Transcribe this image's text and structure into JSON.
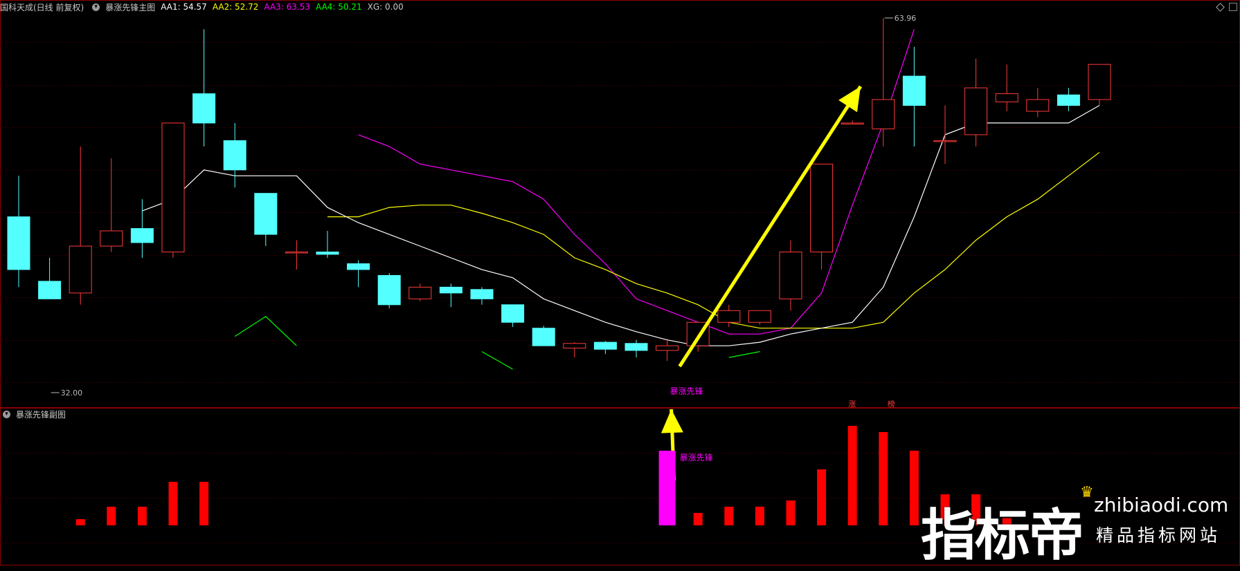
{
  "main_panel": {
    "title": "国科天成(日线 前复权)",
    "indicator": "暴涨先锋主图",
    "values": [
      {
        "label": "AA1: 54.57",
        "color": "#ffffff"
      },
      {
        "label": "AA2: 52.72",
        "color": "#ffff00"
      },
      {
        "label": "AA3: 63.53",
        "color": "#ff00ff"
      },
      {
        "label": "AA4: 50.21",
        "color": "#00ff00"
      },
      {
        "label": "XG: 0.00",
        "color": "#c8c8c8"
      }
    ],
    "high_marker": "63.96",
    "low_marker": "32.00",
    "signal_label": "暴涨先锋",
    "tag_zhang": "涨",
    "tag_bang": "榜"
  },
  "sub_panel": {
    "title": "暴涨先锋副图",
    "signal_label": "暴涨先锋"
  },
  "watermark": {
    "brand": "指标帝",
    "url": "zhibiaodi.com",
    "slogan": "精品指标网站"
  },
  "colors": {
    "up": "#ff3b3b",
    "down": "#54ffff",
    "grid": "#5a0000",
    "aa1": "#ffffff",
    "aa2": "#ffff00",
    "aa3": "#ff00ff",
    "aa4": "#00ff00",
    "arrow": "#ffff00",
    "signal_bar": "#ff00ff",
    "volume_bar": "#ff0000"
  },
  "chart_data": {
    "type": "candlestick",
    "price_range": [
      32.0,
      63.96
    ],
    "candles": [
      {
        "o": 47.0,
        "h": 50.5,
        "l": 41.0,
        "c": 42.5
      },
      {
        "o": 41.5,
        "h": 43.5,
        "l": 40.5,
        "c": 40.0
      },
      {
        "o": 40.5,
        "h": 53.0,
        "l": 39.5,
        "c": 44.5
      },
      {
        "o": 44.5,
        "h": 52.0,
        "l": 44.0,
        "c": 45.8
      },
      {
        "o": 46.0,
        "h": 48.5,
        "l": 43.5,
        "c": 44.8
      },
      {
        "o": 44.0,
        "h": 55.0,
        "l": 43.5,
        "c": 55.0
      },
      {
        "o": 57.5,
        "h": 63.0,
        "l": 53.0,
        "c": 55.0
      },
      {
        "o": 53.5,
        "h": 55.0,
        "l": 49.5,
        "c": 51.0
      },
      {
        "o": 49.0,
        "h": 48.8,
        "l": 44.5,
        "c": 45.5
      },
      {
        "o": 44.0,
        "h": 45.0,
        "l": 42.5,
        "c": 44.0
      },
      {
        "o": 44.0,
        "h": 45.8,
        "l": 43.5,
        "c": 43.8
      },
      {
        "o": 43.0,
        "h": 43.3,
        "l": 41.0,
        "c": 42.5
      },
      {
        "o": 42.0,
        "h": 42.2,
        "l": 39.2,
        "c": 39.5
      },
      {
        "o": 40.0,
        "h": 41.3,
        "l": 39.8,
        "c": 41.0
      },
      {
        "o": 41.0,
        "h": 41.3,
        "l": 39.3,
        "c": 40.5
      },
      {
        "o": 40.8,
        "h": 41.0,
        "l": 39.5,
        "c": 40.0
      },
      {
        "o": 39.5,
        "h": 39.5,
        "l": 37.6,
        "c": 38.0
      },
      {
        "o": 37.5,
        "h": 37.7,
        "l": 36.0,
        "c": 36.0
      },
      {
        "o": 35.8,
        "h": 36.3,
        "l": 35.0,
        "c": 36.2
      },
      {
        "o": 36.3,
        "h": 36.4,
        "l": 35.3,
        "c": 35.7
      },
      {
        "o": 36.2,
        "h": 36.5,
        "l": 35.0,
        "c": 35.6
      },
      {
        "o": 35.6,
        "h": 36.6,
        "l": 34.7,
        "c": 36.0
      },
      {
        "o": 36.0,
        "h": 38.0,
        "l": 35.5,
        "c": 38.0
      },
      {
        "o": 38.0,
        "h": 39.5,
        "l": 37.6,
        "c": 39.0
      },
      {
        "o": 38.0,
        "h": 39.0,
        "l": 37.8,
        "c": 39.0
      },
      {
        "o": 40.0,
        "h": 45.0,
        "l": 39.0,
        "c": 44.0
      },
      {
        "o": 44.0,
        "h": 50.0,
        "l": 42.5,
        "c": 51.5
      },
      {
        "o": 55.0,
        "h": 55.2,
        "l": 55.0,
        "c": 55.0
      },
      {
        "o": 54.5,
        "h": 63.96,
        "l": 53.0,
        "c": 57.0
      },
      {
        "o": 59.0,
        "h": 61.5,
        "l": 53.0,
        "c": 56.5
      },
      {
        "o": 53.5,
        "h": 56.5,
        "l": 51.5,
        "c": 53.5
      },
      {
        "o": 54.0,
        "h": 60.5,
        "l": 53.0,
        "c": 58.0
      },
      {
        "o": 56.8,
        "h": 60.0,
        "l": 56.0,
        "c": 57.5
      },
      {
        "o": 56.0,
        "h": 58.0,
        "l": 55.5,
        "c": 57.0
      },
      {
        "o": 57.4,
        "h": 58.0,
        "l": 56.0,
        "c": 56.5
      },
      {
        "o": 57.0,
        "h": 60.0,
        "l": 56.5,
        "c": 60.0
      }
    ],
    "aa1": [
      null,
      null,
      null,
      null,
      47.5,
      48.5,
      51.0,
      50.5,
      50.5,
      50.5,
      47.8,
      46.5,
      45.5,
      44.5,
      43.5,
      42.5,
      41.8,
      40.0,
      39.0,
      38.0,
      37.2,
      36.5,
      36.0,
      36.0,
      36.3,
      37.0,
      37.5,
      38.0,
      41.0,
      47.0,
      54.0,
      55.0,
      55.0,
      55.0,
      55.0,
      56.5
    ],
    "aa2": [
      null,
      null,
      null,
      null,
      null,
      null,
      null,
      null,
      null,
      null,
      47.0,
      47.0,
      47.8,
      48.0,
      48.0,
      47.3,
      46.5,
      45.5,
      43.5,
      42.5,
      41.3,
      40.5,
      39.5,
      38.0,
      37.5,
      37.5,
      37.5,
      37.5,
      38.0,
      40.5,
      42.5,
      45.0,
      47.0,
      48.5,
      50.5,
      52.5
    ],
    "aa3": [
      null,
      null,
      null,
      null,
      null,
      null,
      null,
      null,
      null,
      null,
      null,
      54.0,
      53.0,
      51.5,
      51.0,
      50.5,
      50.0,
      48.5,
      45.5,
      43.0,
      40.0,
      39.0,
      38.0,
      37.0,
      37.0,
      37.5,
      40.5,
      48.0,
      55.0,
      63.0,
      null,
      null,
      null,
      null,
      63.5,
      null
    ],
    "aa4": [
      null,
      null,
      null,
      null,
      null,
      null,
      null,
      36.8,
      38.5,
      36.0,
      null,
      null,
      null,
      null,
      null,
      35.5,
      34.0,
      null,
      null,
      null,
      null,
      null,
      null,
      35.0,
      35.5,
      null,
      null,
      null,
      null,
      null,
      null,
      null,
      null,
      null,
      null,
      50.2
    ],
    "signal_index": 21,
    "sub_values": [
      null,
      null,
      1,
      3,
      3,
      7,
      7,
      null,
      null,
      null,
      null,
      null,
      null,
      null,
      null,
      null,
      null,
      null,
      null,
      null,
      null,
      12,
      2,
      3,
      3,
      4,
      9,
      16,
      15,
      12,
      5,
      5,
      2,
      null,
      null,
      null
    ],
    "sub_signal_index": 21
  }
}
